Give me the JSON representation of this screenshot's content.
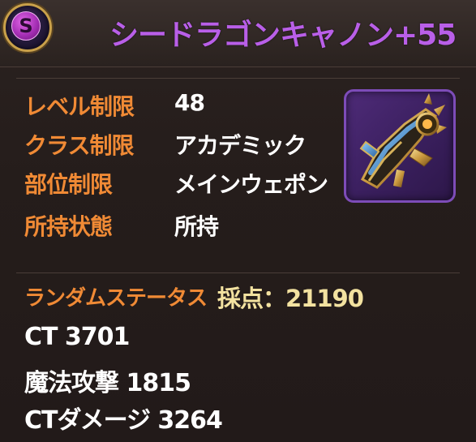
{
  "item": {
    "rank_letter": "S",
    "name": "シードラゴンキャノン+55",
    "icon": "sea-dragon-cannon-icon"
  },
  "properties": [
    {
      "label": "レベル制限",
      "value": "48"
    },
    {
      "label": "クラス制限",
      "value": "アカデミック"
    },
    {
      "label": "部位制限",
      "value": "メインウェポン"
    },
    {
      "label": "所持状態",
      "value": "所持"
    }
  ],
  "random_status": {
    "label": "ランダムステータス",
    "score": "採点：21190",
    "stats": [
      "CT 3701",
      "魔法攻撃 1815",
      "CTダメージ 3264"
    ]
  },
  "colors": {
    "title": "#b95fe8",
    "label": "#f08a35",
    "value": "#ffffff",
    "score": "#f3e2a0",
    "background": "#251d1b"
  }
}
